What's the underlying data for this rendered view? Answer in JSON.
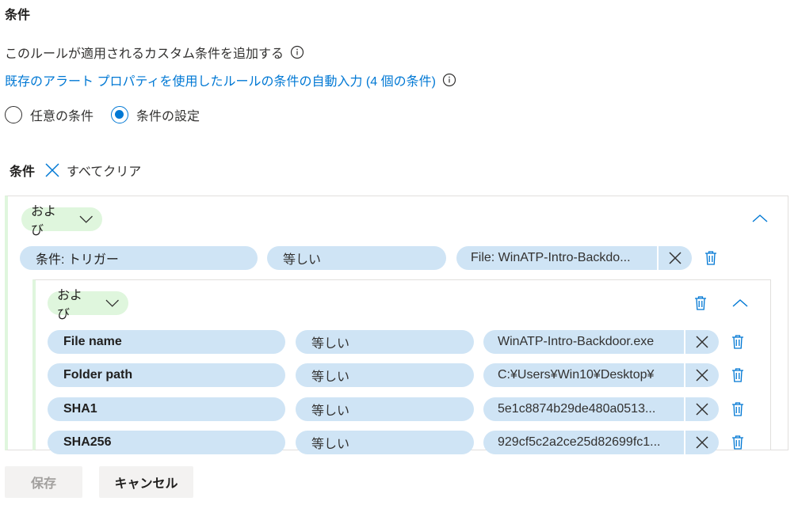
{
  "section_title": "条件",
  "description": "このルールが適用されるカスタム条件を追加する",
  "autofill_link": "既存のアラート プロパティを使用したルールの条件の自動入力 (4 個の条件)",
  "radio_options": [
    {
      "label": "任意の条件",
      "checked": false
    },
    {
      "label": "条件の設定",
      "checked": true
    }
  ],
  "conditions_label": "条件",
  "clear_all_label": "すべてクリア",
  "outer_group": {
    "operator": "および",
    "row": {
      "field": "条件: トリガー",
      "op": "等しい",
      "value": "File: WinATP-Intro-Backdo..."
    }
  },
  "inner_group": {
    "operator": "および",
    "rows": [
      {
        "field": "File name",
        "op": "等しい",
        "value": "WinATP-Intro-Backdoor.exe"
      },
      {
        "field": "Folder path",
        "op": "等しい",
        "value": "C:¥Users¥Win10¥Desktop¥"
      },
      {
        "field": "SHA1",
        "op": "等しい",
        "value": "5e1c8874b29de480a0513..."
      },
      {
        "field": "SHA256",
        "op": "等しい",
        "value": "929cf5c2a2ce25d82699fc1..."
      }
    ]
  },
  "buttons": {
    "save": "保存",
    "cancel": "キャンセル"
  },
  "colors": {
    "accent": "#0078d4",
    "pill_blue": "#cfe4f5",
    "pill_green": "#dff6dd"
  },
  "icons": [
    "info-icon",
    "close-icon",
    "chevron-down-icon",
    "chevron-up-icon",
    "delete-icon"
  ]
}
